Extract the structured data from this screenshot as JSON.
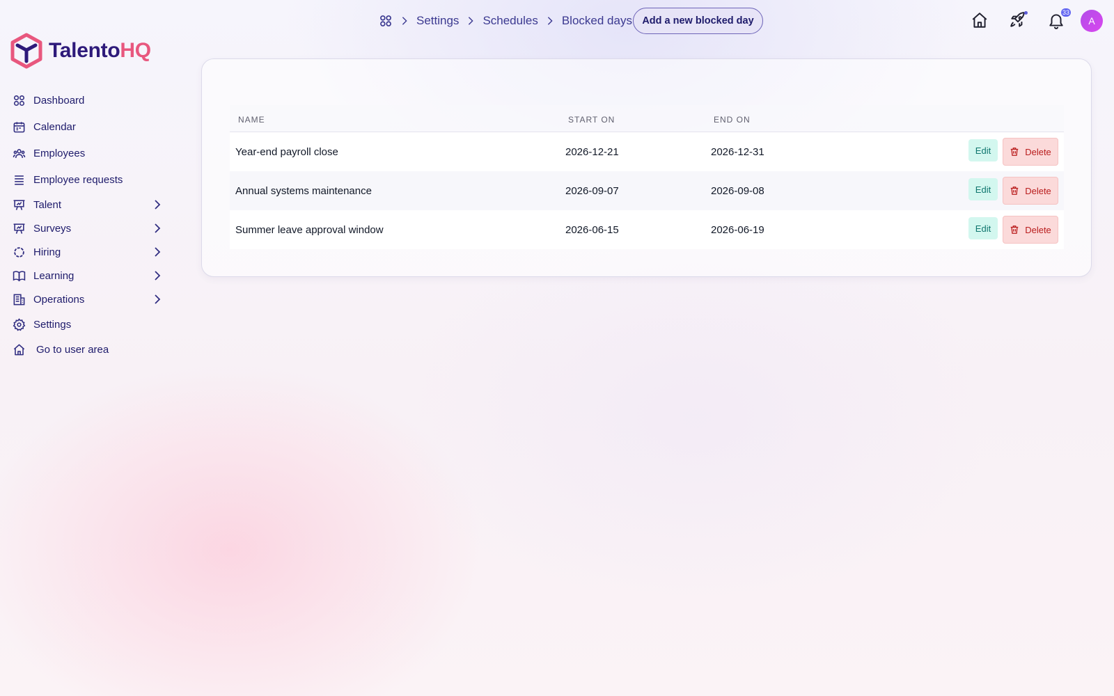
{
  "brand": {
    "name_part1": "Talento",
    "name_part2": "HQ",
    "color_primary": "#2e1a7a",
    "color_accent": "#e8577e"
  },
  "sidebar": {
    "items": [
      {
        "label": "Dashboard",
        "icon": "grid-icon",
        "expandable": false
      },
      {
        "label": "Calendar",
        "icon": "calendar-icon",
        "expandable": false
      },
      {
        "label": "Employees",
        "icon": "users-icon",
        "expandable": false
      },
      {
        "label": "Employee requests",
        "icon": "list-icon",
        "expandable": false
      },
      {
        "label": "Talent",
        "icon": "chart-presentation-icon",
        "expandable": true
      },
      {
        "label": "Surveys",
        "icon": "chart-presentation-icon",
        "expandable": true
      },
      {
        "label": "Hiring",
        "icon": "dashed-circle-icon",
        "expandable": true
      },
      {
        "label": "Learning",
        "icon": "book-icon",
        "expandable": true
      },
      {
        "label": "Operations",
        "icon": "building-icon",
        "expandable": true
      },
      {
        "label": "Settings",
        "icon": "gear-icon",
        "expandable": false
      },
      {
        "label": "Go to user area",
        "icon": "home-icon",
        "expandable": false
      }
    ]
  },
  "header": {
    "breadcrumb": [
      "Settings",
      "Schedules",
      "Blocked days"
    ],
    "add_button_label": "Add a new blocked day",
    "notification_count": "33",
    "avatar_initial": "A"
  },
  "table": {
    "columns": [
      "Name",
      "Start on",
      "End on"
    ],
    "rows": [
      {
        "name": "Year-end payroll close",
        "start": "2026-12-21",
        "end": "2026-12-31"
      },
      {
        "name": "Annual systems maintenance",
        "start": "2026-09-07",
        "end": "2026-09-08"
      },
      {
        "name": "Summer leave approval window",
        "start": "2026-06-15",
        "end": "2026-06-19"
      }
    ],
    "edit_label": "Edit",
    "delete_label": "Delete"
  }
}
